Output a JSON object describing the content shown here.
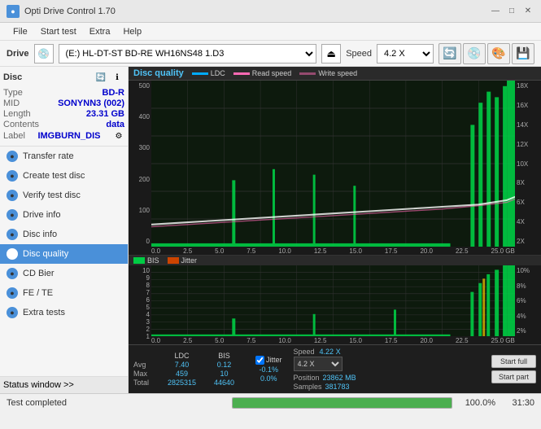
{
  "titlebar": {
    "title": "Opti Drive Control 1.70",
    "min_btn": "—",
    "max_btn": "□",
    "close_btn": "✕"
  },
  "menu": {
    "items": [
      "File",
      "Start test",
      "Extra",
      "Help"
    ]
  },
  "drivebar": {
    "label": "Drive",
    "drive_value": "(E:)  HL-DT-ST BD-RE  WH16NS48 1.D3",
    "speed_label": "Speed",
    "speed_value": "4.2 X"
  },
  "disc": {
    "title": "Disc",
    "type_label": "Type",
    "type_value": "BD-R",
    "mid_label": "MID",
    "mid_value": "SONYNN3 (002)",
    "length_label": "Length",
    "length_value": "23.31 GB",
    "contents_label": "Contents",
    "contents_value": "data",
    "label_label": "Label",
    "label_value": "IMGBURN_DIS"
  },
  "nav": {
    "items": [
      {
        "id": "transfer-rate",
        "label": "Transfer rate",
        "active": false
      },
      {
        "id": "create-test-disc",
        "label": "Create test disc",
        "active": false
      },
      {
        "id": "verify-test-disc",
        "label": "Verify test disc",
        "active": false
      },
      {
        "id": "drive-info",
        "label": "Drive info",
        "active": false
      },
      {
        "id": "disc-info",
        "label": "Disc info",
        "active": false
      },
      {
        "id": "disc-quality",
        "label": "Disc quality",
        "active": true
      },
      {
        "id": "cd-bier",
        "label": "CD Bier",
        "active": false
      },
      {
        "id": "fe-te",
        "label": "FE / TE",
        "active": false
      },
      {
        "id": "extra-tests",
        "label": "Extra tests",
        "active": false
      }
    ]
  },
  "chart": {
    "title": "Disc quality",
    "legend": {
      "ldc": "LDC",
      "read_speed": "Read speed",
      "write_speed": "Write speed"
    },
    "top": {
      "y_left": [
        "500",
        "400",
        "300",
        "200",
        "100",
        "0"
      ],
      "y_right": [
        "18X",
        "16X",
        "14X",
        "12X",
        "10X",
        "8X",
        "6X",
        "4X",
        "2X"
      ],
      "x_labels": [
        "0.0",
        "2.5",
        "5.0",
        "7.5",
        "10.0",
        "12.5",
        "15.0",
        "17.5",
        "20.0",
        "22.5"
      ],
      "x_unit": "25.0 GB"
    },
    "bottom": {
      "title_bis": "BIS",
      "title_jitter": "Jitter",
      "y_left": [
        "10",
        "9",
        "8",
        "7",
        "6",
        "5",
        "4",
        "3",
        "2",
        "1"
      ],
      "y_right": [
        "10%",
        "8%",
        "6%",
        "4%",
        "2%"
      ],
      "x_labels": [
        "0.0",
        "2.5",
        "5.0",
        "7.5",
        "10.0",
        "12.5",
        "15.0",
        "17.5",
        "20.0",
        "22.5"
      ],
      "x_unit": "25.0 GB"
    }
  },
  "stats": {
    "headers": [
      "",
      "LDC",
      "BIS",
      "",
      "Jitter",
      "Speed",
      "",
      ""
    ],
    "avg_label": "Avg",
    "avg_ldc": "7.40",
    "avg_bis": "0.12",
    "avg_jitter": "-0.1%",
    "max_label": "Max",
    "max_ldc": "459",
    "max_bis": "10",
    "max_jitter": "0.0%",
    "total_label": "Total",
    "total_ldc": "2825315",
    "total_bis": "44640",
    "speed_label": "Speed",
    "speed_value": "4.22 X",
    "speed_select": "4.2 X",
    "position_label": "Position",
    "position_value": "23862 MB",
    "samples_label": "Samples",
    "samples_value": "381783",
    "jitter_checked": true,
    "btn_start_full": "Start full",
    "btn_start_part": "Start part"
  },
  "statusbar": {
    "left_label": "Status window >>",
    "status_text": "Test completed",
    "progress_pct": "100.0%",
    "progress_time": "31:30"
  }
}
